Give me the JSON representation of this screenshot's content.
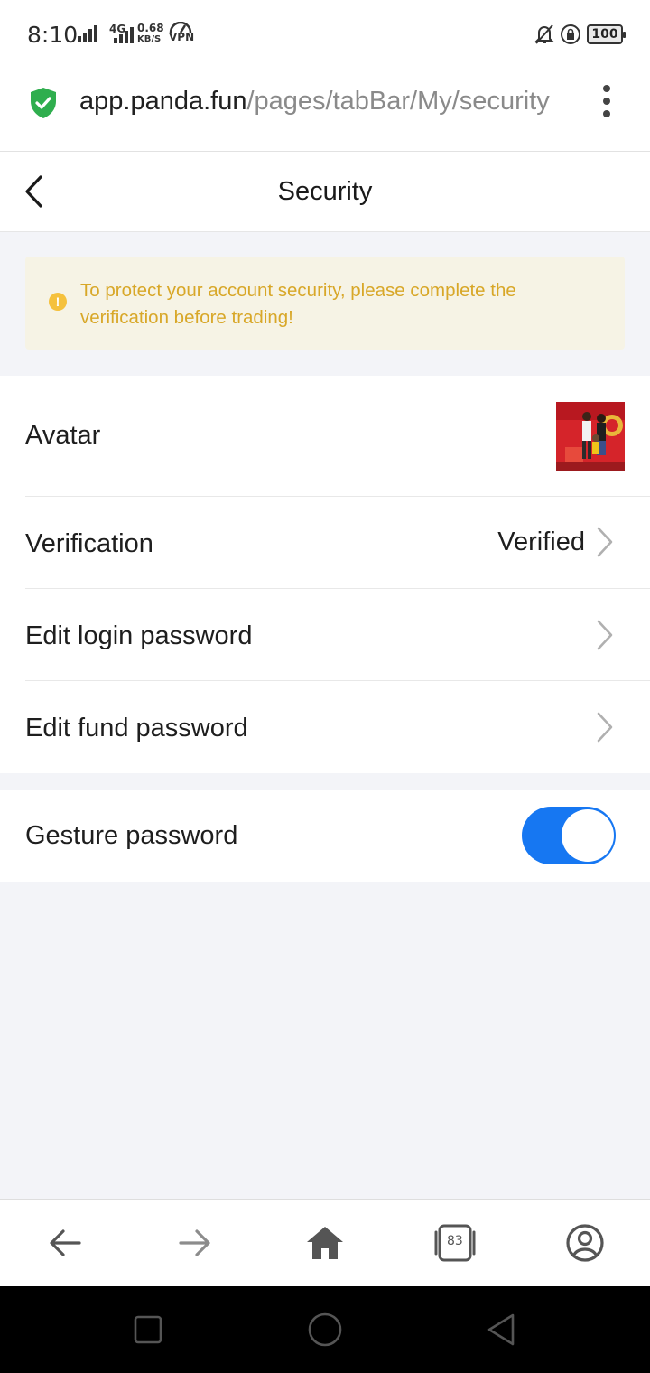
{
  "status_bar": {
    "time": "8:10",
    "network_type": "4G",
    "speed_value": "0.68",
    "speed_unit": "KB/S",
    "vpn_label": "VPN",
    "battery": "100"
  },
  "browser": {
    "url_host": "app.panda.fun",
    "url_path": "/pages/tabBar/My/security",
    "tabs_count": "83"
  },
  "header": {
    "title": "Security"
  },
  "notice": {
    "text": "To protect your account security, please complete the verification before trading!",
    "icon": "exclamation-icon",
    "text_color": "#d8a728",
    "background": "#f6f3e5"
  },
  "settings": {
    "avatar_label": "Avatar",
    "verification_label": "Verification",
    "verification_value": "Verified",
    "login_password_label": "Edit login password",
    "fund_password_label": "Edit fund password",
    "gesture_password_label": "Gesture password",
    "gesture_password_enabled": true
  },
  "colors": {
    "accent": "#1677f2",
    "background": "#f3f4f8",
    "secure_green": "#2fae4e"
  }
}
